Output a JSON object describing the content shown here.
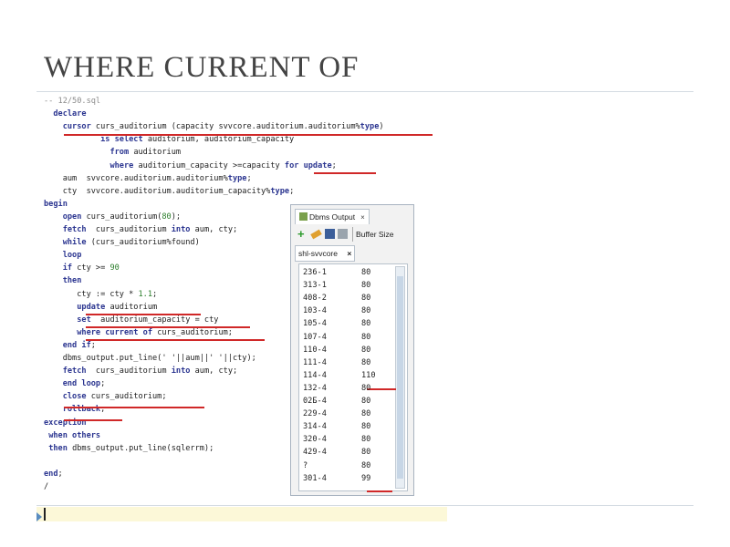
{
  "slide": {
    "title": "WHERE CURRENT OF"
  },
  "code": [
    [
      {
        "t": "-- 12/50.sql",
        "c": "cm"
      }
    ],
    [
      {
        "t": "  "
      },
      {
        "t": "declare",
        "c": "kw"
      }
    ],
    [
      {
        "t": "    "
      },
      {
        "t": "cursor",
        "c": "kw"
      },
      {
        "t": " curs_auditorium (capacity svvcore.auditorium.auditorium%"
      },
      {
        "t": "type",
        "c": "kw"
      },
      {
        "t": ")"
      }
    ],
    [
      {
        "t": "            "
      },
      {
        "t": "is select",
        "c": "kw"
      },
      {
        "t": " auditorium, auditorium_capacity"
      }
    ],
    [
      {
        "t": "              "
      },
      {
        "t": "from",
        "c": "kw"
      },
      {
        "t": " auditorium"
      }
    ],
    [
      {
        "t": "              "
      },
      {
        "t": "where",
        "c": "kw"
      },
      {
        "t": " auditorium_capacity >=capacity "
      },
      {
        "t": "for update",
        "c": "kw"
      },
      {
        "t": ";"
      }
    ],
    [
      {
        "t": "    aum  svvcore.auditorium.auditorium%"
      },
      {
        "t": "type",
        "c": "kw"
      },
      {
        "t": ";"
      }
    ],
    [
      {
        "t": "    cty  svvcore.auditorium.auditorium_capacity%"
      },
      {
        "t": "type",
        "c": "kw"
      },
      {
        "t": ";"
      }
    ],
    [
      {
        "t": "begin",
        "c": "kw"
      }
    ],
    [
      {
        "t": "    "
      },
      {
        "t": "open",
        "c": "kw"
      },
      {
        "t": " curs_auditorium("
      },
      {
        "t": "80",
        "c": "num"
      },
      {
        "t": ");"
      }
    ],
    [
      {
        "t": "    "
      },
      {
        "t": "fetch",
        "c": "kw"
      },
      {
        "t": "  curs_auditorium "
      },
      {
        "t": "into",
        "c": "kw"
      },
      {
        "t": " aum, cty;"
      }
    ],
    [
      {
        "t": "    "
      },
      {
        "t": "while",
        "c": "kw"
      },
      {
        "t": " (curs_auditorium%found)"
      }
    ],
    [
      {
        "t": "    "
      },
      {
        "t": "loop",
        "c": "kw"
      }
    ],
    [
      {
        "t": "    "
      },
      {
        "t": "if",
        "c": "kw"
      },
      {
        "t": " cty >= "
      },
      {
        "t": "90",
        "c": "num"
      }
    ],
    [
      {
        "t": "    "
      },
      {
        "t": "then",
        "c": "kw"
      }
    ],
    [
      {
        "t": "       cty := cty * "
      },
      {
        "t": "1.1",
        "c": "num"
      },
      {
        "t": ";"
      }
    ],
    [
      {
        "t": "       "
      },
      {
        "t": "update",
        "c": "kw"
      },
      {
        "t": " auditorium"
      }
    ],
    [
      {
        "t": "       "
      },
      {
        "t": "set",
        "c": "kw"
      },
      {
        "t": "  auditorium_capacity = cty"
      }
    ],
    [
      {
        "t": "       "
      },
      {
        "t": "where current of",
        "c": "kw"
      },
      {
        "t": " curs_auditorium;"
      }
    ],
    [
      {
        "t": "    "
      },
      {
        "t": "end if",
        "c": "kw"
      },
      {
        "t": ";"
      }
    ],
    [
      {
        "t": "    dbms_output.put_line(' '||aum||' '||cty);"
      }
    ],
    [
      {
        "t": "    "
      },
      {
        "t": "fetch",
        "c": "kw"
      },
      {
        "t": "  curs_auditorium "
      },
      {
        "t": "into",
        "c": "kw"
      },
      {
        "t": " aum, cty;"
      }
    ],
    [
      {
        "t": "    "
      },
      {
        "t": "end loop",
        "c": "kw"
      },
      {
        "t": ";"
      }
    ],
    [
      {
        "t": "    "
      },
      {
        "t": "close",
        "c": "kw"
      },
      {
        "t": " curs_auditorium;"
      }
    ],
    [
      {
        "t": "    "
      },
      {
        "t": "rollback",
        "c": "kw"
      },
      {
        "t": ";"
      }
    ],
    [
      {
        "t": "exception",
        "c": "kw"
      }
    ],
    [
      {
        "t": " "
      },
      {
        "t": "when others",
        "c": "kw"
      }
    ],
    [
      {
        "t": " "
      },
      {
        "t": "then",
        "c": "kw"
      },
      {
        "t": " dbms_output.put_line(sqlerrm);"
      }
    ],
    [
      {
        "t": ""
      }
    ],
    [
      {
        "t": "end",
        "c": "kw"
      },
      {
        "t": ";"
      }
    ],
    [
      {
        "t": "/"
      }
    ]
  ],
  "dbms_panel": {
    "tab_label": "Dbms Output",
    "close_glyph": "×",
    "toolbar_label": "Buffer Size",
    "connection_tab": "shl-svvcore",
    "connection_close": "×",
    "rows": [
      [
        "236-1",
        "80"
      ],
      [
        "313-1",
        "80"
      ],
      [
        "408-2",
        "80"
      ],
      [
        "103-4",
        "80"
      ],
      [
        "105-4",
        "80"
      ],
      [
        "107-4",
        "80"
      ],
      [
        "110-4",
        "80"
      ],
      [
        "111-4",
        "80"
      ],
      [
        "114-4",
        "110"
      ],
      [
        "132-4",
        "80"
      ],
      [
        "02Б-4",
        "80"
      ],
      [
        "229-4",
        "80"
      ],
      [
        "314-4",
        "80"
      ],
      [
        "320-4",
        "80"
      ],
      [
        "429-4",
        "80"
      ],
      [
        "?",
        "80"
      ],
      [
        "301-4",
        "99"
      ]
    ]
  },
  "colors": {
    "highlight": "#d02828",
    "keyword": "#2b3590"
  }
}
